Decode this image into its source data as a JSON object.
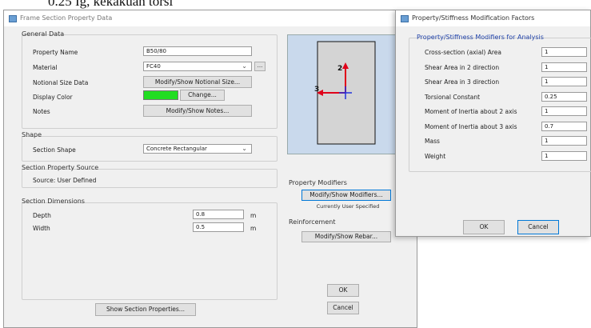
{
  "caption": "0.25 Ig, kekakuan torsi",
  "main_window": {
    "title": "Frame Section Property Data",
    "general_data": {
      "title": "General Data",
      "property_name_label": "Property Name",
      "property_name_value": "B50/80",
      "material_label": "Material",
      "material_value": "FC40",
      "material_more": "...",
      "notional_label": "Notional Size Data",
      "notional_button": "Modify/Show Notional Size...",
      "display_color_label": "Display Color",
      "display_color_value": "#22dd22",
      "change_button": "Change...",
      "notes_label": "Notes",
      "notes_button": "Modify/Show Notes..."
    },
    "shape": {
      "title": "Shape",
      "section_shape_label": "Section Shape",
      "section_shape_value": "Concrete Rectangular"
    },
    "source": {
      "title": "Section Property Source",
      "source_text": "Source:  User Defined"
    },
    "dimensions": {
      "title": "Section Dimensions",
      "depth_label": "Depth",
      "depth_value": "0.8",
      "width_label": "Width",
      "width_value": "0.5",
      "unit": "m"
    },
    "diagram": {
      "axis2_label": "2",
      "axis3_label": "3"
    },
    "property_modifiers": {
      "title": "Property Modifiers",
      "button": "Modify/Show Modifiers...",
      "status": "Currently User Specified"
    },
    "reinforcement": {
      "title": "Reinforcement",
      "button": "Modify/Show Rebar..."
    },
    "show_properties_button": "Show Section Properties...",
    "ok_button": "OK",
    "cancel_button": "Cancel"
  },
  "modifiers_dialog": {
    "title": "Property/Stiffness Modification Factors",
    "group_title": "Property/Stiffness Modifiers for Analysis",
    "rows": [
      {
        "label": "Cross-section (axial) Area",
        "value": "1"
      },
      {
        "label": "Shear Area in 2 direction",
        "value": "1"
      },
      {
        "label": "Shear Area in 3 direction",
        "value": "1"
      },
      {
        "label": "Torsional Constant",
        "value": "0.25"
      },
      {
        "label": "Moment of Inertia about 2 axis",
        "value": "1"
      },
      {
        "label": "Moment of Inertia about 3 axis",
        "value": "0.7"
      },
      {
        "label": "Mass",
        "value": "1"
      },
      {
        "label": "Weight",
        "value": "1"
      }
    ],
    "ok_button": "OK",
    "cancel_button": "Cancel"
  },
  "colors": {
    "axis_red": "#e0001a",
    "axis_blue": "#2233dd",
    "preview_bg": "#c9d9ec",
    "section_fill": "#d4d4d4"
  }
}
